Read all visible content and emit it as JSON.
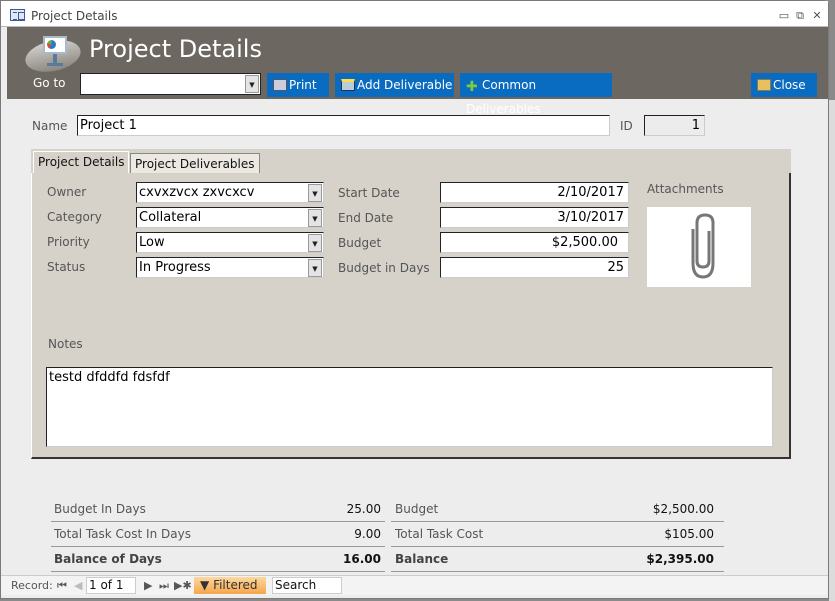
{
  "window": {
    "title": "Project Details",
    "controls": [
      "minimize",
      "restore",
      "close"
    ]
  },
  "header": {
    "title": "Project Details",
    "goto_label": "Go to",
    "goto_value": "",
    "buttons": {
      "print": "Print",
      "add_deliverable": "Add Deliverable",
      "common_deliverables": "Common Deliverables",
      "close": "Close"
    }
  },
  "form": {
    "name_label": "Name",
    "name_value": "Project 1",
    "id_label": "ID",
    "id_value": "1"
  },
  "tabs": [
    {
      "label": "Project Details",
      "active": true
    },
    {
      "label": "Project Deliverables",
      "active": false
    }
  ],
  "details": {
    "owner_label": "Owner",
    "owner_value": "cxvxzvcx zxvcxcv",
    "category_label": "Category",
    "category_value": "Collateral",
    "priority_label": "Priority",
    "priority_value": "Low",
    "status_label": "Status",
    "status_value": "In Progress",
    "start_date_label": "Start Date",
    "start_date_value": "2/10/2017",
    "end_date_label": "End Date",
    "end_date_value": "3/10/2017",
    "budget_label": "Budget",
    "budget_value": "$2,500.00",
    "budget_days_label": "Budget in Days",
    "budget_days_value": "25",
    "attachments_label": "Attachments",
    "notes_label": "Notes",
    "notes_value": "testd dfddfd fdsfdf"
  },
  "summary": {
    "left": [
      {
        "label": "Budget In Days",
        "value": "25.00",
        "bold": false
      },
      {
        "label": "Total Task Cost In Days",
        "value": "9.00",
        "bold": false
      },
      {
        "label": "Balance of Days",
        "value": "16.00",
        "bold": true
      }
    ],
    "right": [
      {
        "label": "Budget",
        "value": "$2,500.00",
        "bold": false
      },
      {
        "label": "Total Task Cost",
        "value": "$105.00",
        "bold": false
      },
      {
        "label": "Balance",
        "value": "$2,395.00",
        "bold": true
      }
    ]
  },
  "statusbar": {
    "record_label": "Record:",
    "record_value": "1 of 1",
    "filter_label": "Filtered",
    "search_placeholder": "Search"
  }
}
